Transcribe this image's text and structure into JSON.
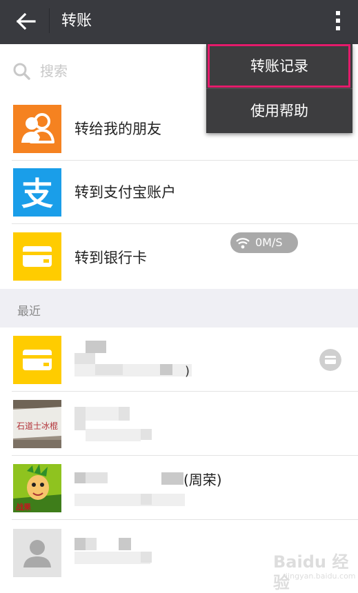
{
  "header": {
    "title": "转账"
  },
  "search": {
    "placeholder": "搜索"
  },
  "options": [
    {
      "label": "转给我的朋友",
      "icon": "friends-icon",
      "color": "#f58220"
    },
    {
      "label": "转到支付宝账户",
      "icon": "alipay-icon",
      "color": "#1a9ee9"
    },
    {
      "label": "转到银行卡",
      "icon": "bank-card-icon",
      "color": "#ffcc00"
    }
  ],
  "network_indicator": {
    "text": "0M/S"
  },
  "recent": {
    "title": "最近",
    "items": [
      {
        "icon": "bank-card-icon",
        "visible_fragment": ")"
      },
      {
        "icon": "contact-photo",
        "visible_fragment": ""
      },
      {
        "icon": "contact-cartoon-avatar",
        "visible_fragment": "(周荣)"
      },
      {
        "icon": "default-avatar-icon",
        "visible_fragment": ""
      }
    ]
  },
  "menu": {
    "items": [
      {
        "label": "转账记录",
        "highlighted": true
      },
      {
        "label": "使用帮助",
        "highlighted": false
      }
    ]
  },
  "watermark": {
    "text": "Baidu 经验",
    "sub": "jingyan.baidu.com"
  }
}
